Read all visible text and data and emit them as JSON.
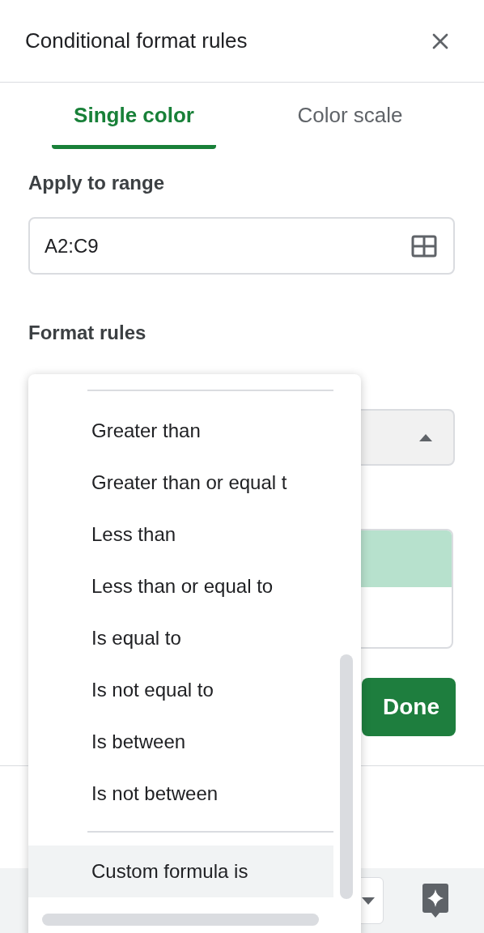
{
  "panel": {
    "title": "Conditional format rules"
  },
  "tabs": [
    {
      "label": "Single color",
      "selected": true
    },
    {
      "label": "Color scale",
      "selected": false
    }
  ],
  "range": {
    "label": "Apply to range",
    "value": "A2:C9"
  },
  "format_rules": {
    "label": "Format rules"
  },
  "done_button": {
    "label": "Done"
  },
  "menu": {
    "groups": [
      [
        {
          "label": "Greater than",
          "selected": false
        },
        {
          "label": "Greater than or equal t",
          "selected": false
        },
        {
          "label": "Less than",
          "selected": false
        },
        {
          "label": "Less than or equal to",
          "selected": false
        },
        {
          "label": "Is equal to",
          "selected": false
        },
        {
          "label": "Is not equal to",
          "selected": false
        },
        {
          "label": "Is between",
          "selected": false
        },
        {
          "label": "Is not between",
          "selected": false
        }
      ],
      [
        {
          "label": "Custom formula is",
          "selected": true
        }
      ]
    ]
  }
}
